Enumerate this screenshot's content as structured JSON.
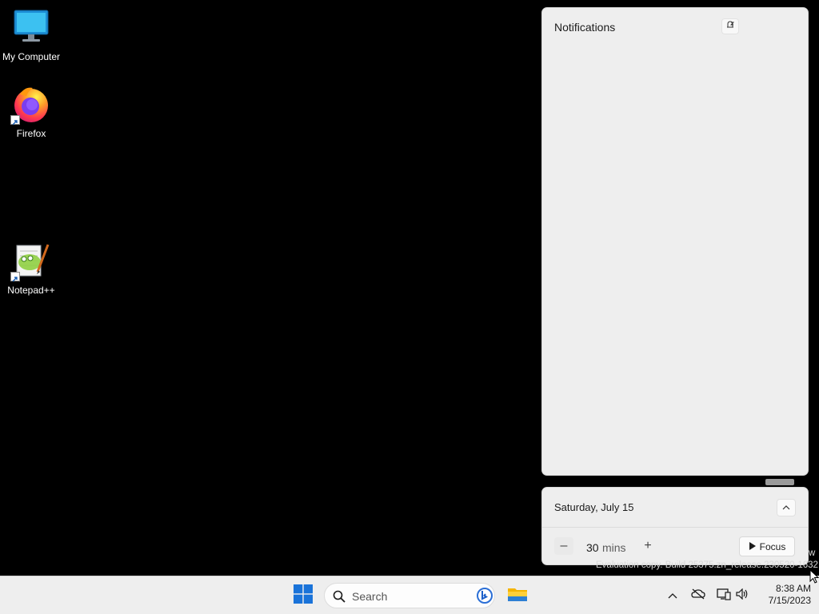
{
  "desktop": {
    "icons": [
      {
        "label": "My Computer",
        "icon": "monitor-icon"
      },
      {
        "label": "Firefox",
        "icon": "firefox-icon"
      },
      {
        "label": "Notepad++",
        "icon": "notepadpp-icon"
      }
    ]
  },
  "notifications": {
    "title": "Notifications",
    "dnd_icon": "do-not-disturb-icon"
  },
  "calendar": {
    "date": "Saturday, July 15",
    "focus": {
      "minutes": "30",
      "unit": "mins",
      "decrease_label": "–",
      "increase_label": "+",
      "button_label": "Focus"
    }
  },
  "watermark": {
    "line1_tail": "w",
    "line2": "Evaluation copy. Build 25375.zn_release.230520-1632"
  },
  "taskbar": {
    "search_placeholder": "Search",
    "tray_icons": [
      "chevron-up-icon",
      "onedrive-offline-icon",
      "network-icon",
      "volume-icon"
    ],
    "clock": {
      "time": "8:38 AM",
      "date": "7/15/2023"
    }
  },
  "colors": {
    "desktop_bg": "#000000",
    "panel_bg": "#eeeeee",
    "taskbar_bg": "#eeeeee",
    "windows_blue": "#1a73d9"
  }
}
